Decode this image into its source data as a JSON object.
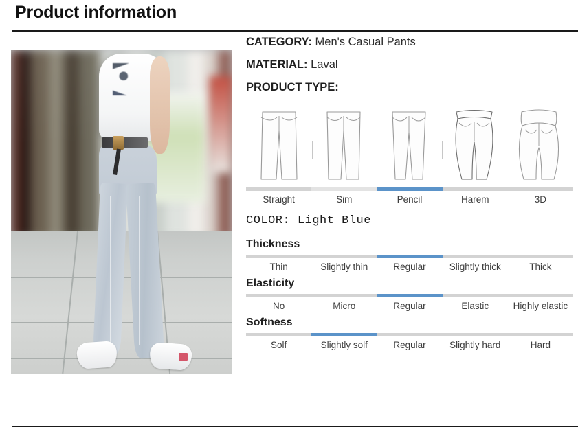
{
  "header": {
    "title": "Product information"
  },
  "photo": {
    "alt_name": "model-wearing-light-blue-casual-pants"
  },
  "details": {
    "category": {
      "label": "CATEGORY:",
      "value": "Men's Casual Pants"
    },
    "material": {
      "label": "MATERIAL:",
      "value": "Laval"
    },
    "product_type": {
      "label": "PRODUCT TYPE:"
    },
    "color": {
      "text": "COLOR: Light Blue"
    }
  },
  "product_type": {
    "options": [
      "Straight",
      "Sim",
      "Pencil",
      "Harem",
      "3D"
    ],
    "selected_index": 2,
    "icons": [
      "straight-pants-icon",
      "slim-pants-icon",
      "pencil-pants-icon",
      "harem-pants-icon",
      "3d-pants-icon"
    ]
  },
  "attributes": [
    {
      "name": "thickness",
      "title": "Thickness",
      "options": [
        "Thin",
        "Slightly thin",
        "Regular",
        "Slightly thick",
        "Thick"
      ],
      "selected_index": 2
    },
    {
      "name": "elasticity",
      "title": "Elasticity",
      "options": [
        "No",
        "Micro",
        "Regular",
        "Elastic",
        "Highly elastic"
      ],
      "selected_index": 2
    },
    {
      "name": "softness",
      "title": "Softness",
      "options": [
        "Solf",
        "Slightly solf",
        "Regular",
        "Slightly hard",
        "Hard"
      ],
      "selected_index": 1
    }
  ],
  "colors": {
    "accent_selected": "#5b93c9",
    "track": "#d3d3d3",
    "rule": "#1a1a1a",
    "text": "#1f1f1f"
  }
}
